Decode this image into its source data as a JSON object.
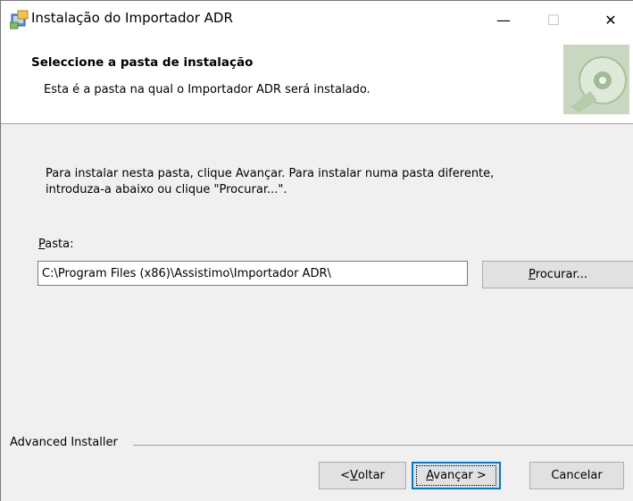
{
  "window": {
    "title": "Instalação do Importador ADR",
    "controls": {
      "minimize": "—",
      "maximize": "☐",
      "close": "✕"
    }
  },
  "header": {
    "title": "Seleccione a pasta de instalação",
    "subtitle": "Esta é a pasta na qual o Importador ADR será instalado."
  },
  "content": {
    "line1": "Para instalar nesta pasta, clique Avançar. Para instalar numa pasta diferente,",
    "line2": "introduza-a abaixo ou clique \"Procurar...\".",
    "folder_label_mnemonic": "P",
    "folder_label_rest": "asta:",
    "folder_value": "C:\\Program Files (x86)\\Assistimo\\Importador ADR\\",
    "browse_mnemonic": "P",
    "browse_rest": "rocurar..."
  },
  "footer": {
    "brand": "Advanced Installer",
    "back_prefix": "< ",
    "back_mnemonic": "V",
    "back_rest": "oltar",
    "next_mnemonic": "A",
    "next_rest": "vançar >",
    "cancel_label": "Cancelar"
  },
  "icons": {
    "app": "installer-icon",
    "logo": "disc-logo-icon"
  },
  "colors": {
    "accent": "#0078d7",
    "button": "#e1e1e1",
    "panel": "#f0f0f0"
  }
}
